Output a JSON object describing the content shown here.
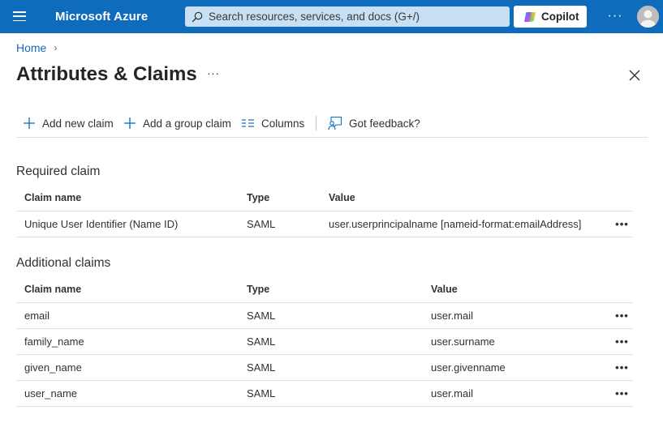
{
  "header": {
    "brand": "Microsoft Azure",
    "search_placeholder": "Search resources, services, and docs (G+/)",
    "copilot_label": "Copilot",
    "more_label": "···"
  },
  "breadcrumb": {
    "home": "Home",
    "separator": "›"
  },
  "page": {
    "title": "Attributes & Claims",
    "more_label": "···",
    "close_label": "Close"
  },
  "toolbar": {
    "add_new_claim": "Add new claim",
    "add_group_claim": "Add a group claim",
    "columns": "Columns",
    "feedback": "Got feedback?"
  },
  "required_claims": {
    "title": "Required claim",
    "columns": [
      "Claim name",
      "Type",
      "Value"
    ],
    "rows": [
      {
        "name": "Unique User Identifier (Name ID)",
        "type": "SAML",
        "value": "user.userprincipalname [nameid-format:emailAddress]",
        "more": "•••"
      }
    ]
  },
  "additional_claims": {
    "title": "Additional claims",
    "columns": [
      "Claim name",
      "Type",
      "Value"
    ],
    "rows": [
      {
        "name": "email",
        "type": "SAML",
        "value": "user.mail",
        "more": "•••"
      },
      {
        "name": "family_name",
        "type": "SAML",
        "value": "user.surname",
        "more": "•••"
      },
      {
        "name": "given_name",
        "type": "SAML",
        "value": "user.givenname",
        "more": "•••"
      },
      {
        "name": "user_name",
        "type": "SAML",
        "value": "user.mail",
        "more": "•••"
      }
    ]
  },
  "colors": {
    "header_bg": "#0f6cbd",
    "search_bg": "#c7e0f4",
    "accent": "#0f6cbd",
    "border": "#e1dfdd"
  },
  "icons": {
    "menu": "hamburger-icon",
    "search": "search-icon",
    "copilot": "copilot-icon",
    "avatar": "user-avatar-icon",
    "close": "close-icon",
    "add": "plus-icon",
    "columns": "columns-icon",
    "feedback": "feedback-icon",
    "more": "ellipsis-icon"
  }
}
